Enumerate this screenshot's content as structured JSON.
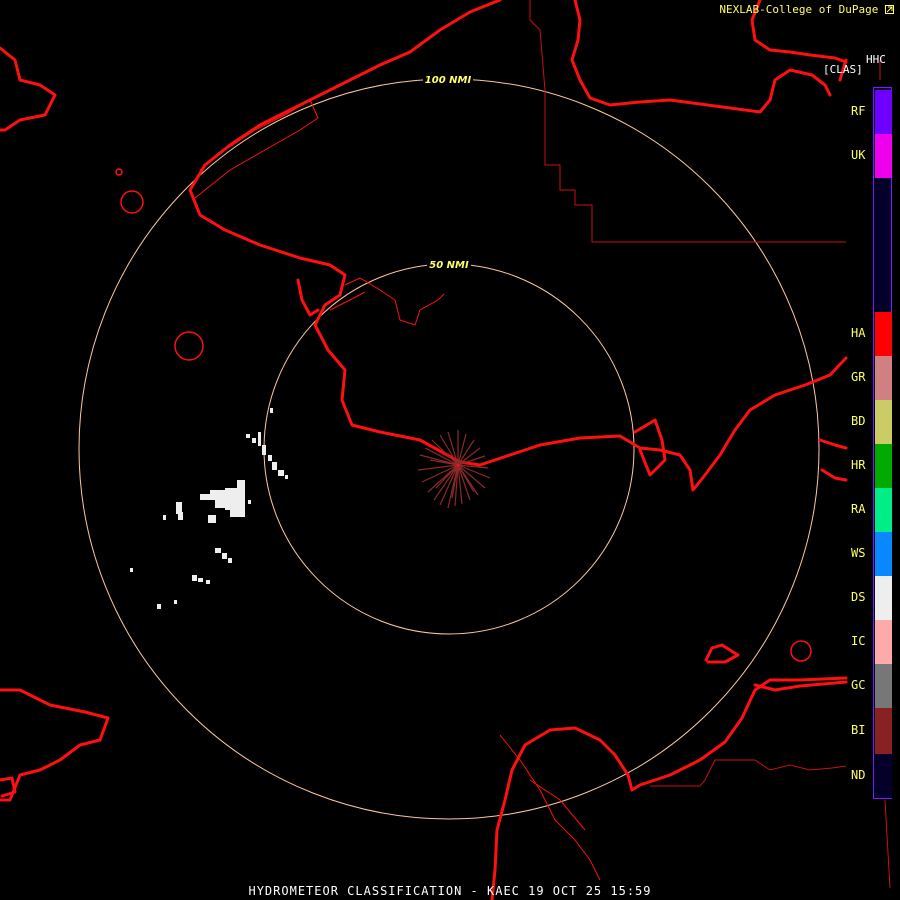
{
  "credit": "NEXLAB-College of DuPage",
  "credit_icon": "external-link-icon",
  "product_code": "HHC",
  "product_label": "[CLAS]",
  "footer": "HYDROMETEOR CLASSIFICATION - KAEC 19 OCT 25 15:59",
  "range_rings": [
    "100 NMI",
    "50 NMI"
  ],
  "legend": [
    {
      "code": "RF",
      "color": "#6f00ff"
    },
    {
      "code": "UK",
      "color": "#ee00ee"
    },
    {
      "code": "HA",
      "color": "#ff0000"
    },
    {
      "code": "GR",
      "color": "#d08080"
    },
    {
      "code": "BD",
      "color": "#cccc66"
    },
    {
      "code": "HR",
      "color": "#00aa00"
    },
    {
      "code": "RA",
      "color": "#00ee88"
    },
    {
      "code": "WS",
      "color": "#0a88ff"
    },
    {
      "code": "DS",
      "color": "#eeeeee"
    },
    {
      "code": "IC",
      "color": "#ffaaaa"
    },
    {
      "code": "GC",
      "color": "#777777"
    },
    {
      "code": "BI",
      "color": "#882222"
    },
    {
      "code": "ND",
      "color": "#04002a"
    }
  ],
  "colors": {
    "coastline": "#ff1010",
    "border": "#cc1010",
    "range_ring": "#ffc8a0",
    "text_yellow": "#ffff66",
    "background": "#000000"
  }
}
